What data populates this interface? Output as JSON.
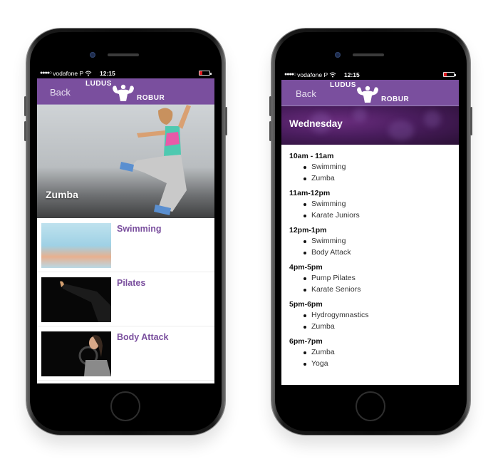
{
  "status_bar": {
    "signal_dots": "●●●●○",
    "carrier": "vodafone P",
    "wifi_icon": "wifi-icon",
    "time": "12:15",
    "battery_icon": "battery-low-icon"
  },
  "brand": {
    "line1": "LUDUS",
    "line2": "ROBUR",
    "accent_color": "#7a4f9e"
  },
  "left_screen": {
    "back_label": "Back",
    "hero_title": "Zumba",
    "classes": [
      {
        "name": "Swimming",
        "image": "swimming-photo"
      },
      {
        "name": "Pilates",
        "image": "pilates-photo"
      },
      {
        "name": "Body Attack",
        "image": "body-attack-photo"
      }
    ]
  },
  "right_screen": {
    "back_label": "Back",
    "day_title": "Wednesday",
    "slots": [
      {
        "time": "10am - 11am",
        "classes": [
          "Swimming",
          "Zumba"
        ]
      },
      {
        "time": "11am-12pm",
        "classes": [
          "Swimming",
          "Karate Juniors"
        ]
      },
      {
        "time": "12pm-1pm",
        "classes": [
          "Swimming",
          "Body Attack"
        ]
      },
      {
        "time": "4pm-5pm",
        "classes": [
          "Pump Pilates",
          "Karate Seniors"
        ]
      },
      {
        "time": "5pm-6pm",
        "classes": [
          "Hydrogymnastics",
          "Zumba"
        ]
      },
      {
        "time": "6pm-7pm",
        "classes": [
          "Zumba",
          "Yoga"
        ]
      }
    ]
  }
}
